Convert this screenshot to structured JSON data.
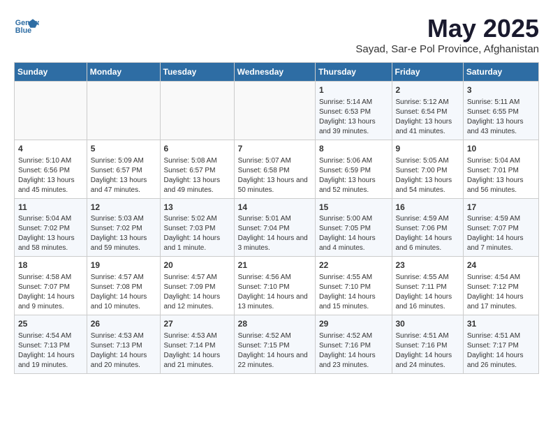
{
  "header": {
    "logo_line1": "General",
    "logo_line2": "Blue",
    "month": "May 2025",
    "location": "Sayad, Sar-e Pol Province, Afghanistan"
  },
  "weekdays": [
    "Sunday",
    "Monday",
    "Tuesday",
    "Wednesday",
    "Thursday",
    "Friday",
    "Saturday"
  ],
  "weeks": [
    [
      {
        "day": "",
        "content": ""
      },
      {
        "day": "",
        "content": ""
      },
      {
        "day": "",
        "content": ""
      },
      {
        "day": "",
        "content": ""
      },
      {
        "day": "1",
        "content": "Sunrise: 5:14 AM\nSunset: 6:53 PM\nDaylight: 13 hours and 39 minutes."
      },
      {
        "day": "2",
        "content": "Sunrise: 5:12 AM\nSunset: 6:54 PM\nDaylight: 13 hours and 41 minutes."
      },
      {
        "day": "3",
        "content": "Sunrise: 5:11 AM\nSunset: 6:55 PM\nDaylight: 13 hours and 43 minutes."
      }
    ],
    [
      {
        "day": "4",
        "content": "Sunrise: 5:10 AM\nSunset: 6:56 PM\nDaylight: 13 hours and 45 minutes."
      },
      {
        "day": "5",
        "content": "Sunrise: 5:09 AM\nSunset: 6:57 PM\nDaylight: 13 hours and 47 minutes."
      },
      {
        "day": "6",
        "content": "Sunrise: 5:08 AM\nSunset: 6:57 PM\nDaylight: 13 hours and 49 minutes."
      },
      {
        "day": "7",
        "content": "Sunrise: 5:07 AM\nSunset: 6:58 PM\nDaylight: 13 hours and 50 minutes."
      },
      {
        "day": "8",
        "content": "Sunrise: 5:06 AM\nSunset: 6:59 PM\nDaylight: 13 hours and 52 minutes."
      },
      {
        "day": "9",
        "content": "Sunrise: 5:05 AM\nSunset: 7:00 PM\nDaylight: 13 hours and 54 minutes."
      },
      {
        "day": "10",
        "content": "Sunrise: 5:04 AM\nSunset: 7:01 PM\nDaylight: 13 hours and 56 minutes."
      }
    ],
    [
      {
        "day": "11",
        "content": "Sunrise: 5:04 AM\nSunset: 7:02 PM\nDaylight: 13 hours and 58 minutes."
      },
      {
        "day": "12",
        "content": "Sunrise: 5:03 AM\nSunset: 7:02 PM\nDaylight: 13 hours and 59 minutes."
      },
      {
        "day": "13",
        "content": "Sunrise: 5:02 AM\nSunset: 7:03 PM\nDaylight: 14 hours and 1 minute."
      },
      {
        "day": "14",
        "content": "Sunrise: 5:01 AM\nSunset: 7:04 PM\nDaylight: 14 hours and 3 minutes."
      },
      {
        "day": "15",
        "content": "Sunrise: 5:00 AM\nSunset: 7:05 PM\nDaylight: 14 hours and 4 minutes."
      },
      {
        "day": "16",
        "content": "Sunrise: 4:59 AM\nSunset: 7:06 PM\nDaylight: 14 hours and 6 minutes."
      },
      {
        "day": "17",
        "content": "Sunrise: 4:59 AM\nSunset: 7:07 PM\nDaylight: 14 hours and 7 minutes."
      }
    ],
    [
      {
        "day": "18",
        "content": "Sunrise: 4:58 AM\nSunset: 7:07 PM\nDaylight: 14 hours and 9 minutes."
      },
      {
        "day": "19",
        "content": "Sunrise: 4:57 AM\nSunset: 7:08 PM\nDaylight: 14 hours and 10 minutes."
      },
      {
        "day": "20",
        "content": "Sunrise: 4:57 AM\nSunset: 7:09 PM\nDaylight: 14 hours and 12 minutes."
      },
      {
        "day": "21",
        "content": "Sunrise: 4:56 AM\nSunset: 7:10 PM\nDaylight: 14 hours and 13 minutes."
      },
      {
        "day": "22",
        "content": "Sunrise: 4:55 AM\nSunset: 7:10 PM\nDaylight: 14 hours and 15 minutes."
      },
      {
        "day": "23",
        "content": "Sunrise: 4:55 AM\nSunset: 7:11 PM\nDaylight: 14 hours and 16 minutes."
      },
      {
        "day": "24",
        "content": "Sunrise: 4:54 AM\nSunset: 7:12 PM\nDaylight: 14 hours and 17 minutes."
      }
    ],
    [
      {
        "day": "25",
        "content": "Sunrise: 4:54 AM\nSunset: 7:13 PM\nDaylight: 14 hours and 19 minutes."
      },
      {
        "day": "26",
        "content": "Sunrise: 4:53 AM\nSunset: 7:13 PM\nDaylight: 14 hours and 20 minutes."
      },
      {
        "day": "27",
        "content": "Sunrise: 4:53 AM\nSunset: 7:14 PM\nDaylight: 14 hours and 21 minutes."
      },
      {
        "day": "28",
        "content": "Sunrise: 4:52 AM\nSunset: 7:15 PM\nDaylight: 14 hours and 22 minutes."
      },
      {
        "day": "29",
        "content": "Sunrise: 4:52 AM\nSunset: 7:16 PM\nDaylight: 14 hours and 23 minutes."
      },
      {
        "day": "30",
        "content": "Sunrise: 4:51 AM\nSunset: 7:16 PM\nDaylight: 14 hours and 24 minutes."
      },
      {
        "day": "31",
        "content": "Sunrise: 4:51 AM\nSunset: 7:17 PM\nDaylight: 14 hours and 26 minutes."
      }
    ]
  ]
}
